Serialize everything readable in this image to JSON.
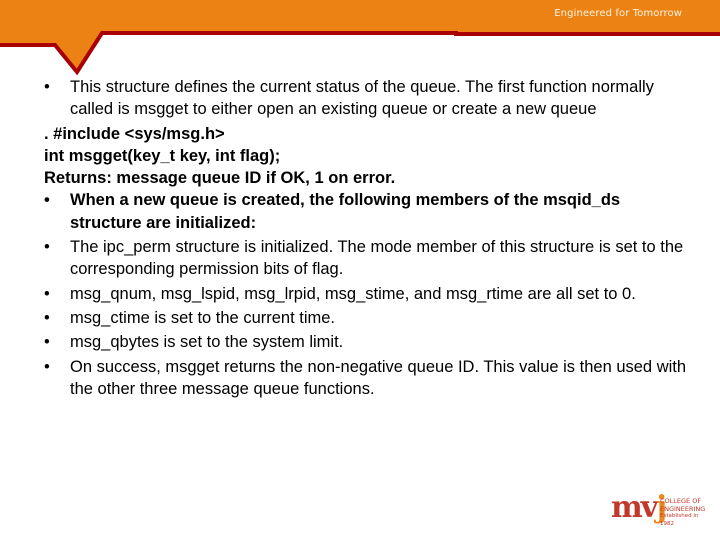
{
  "header": {
    "tagline": "Engineered for Tomorrow",
    "colors": {
      "band": "#ec8213",
      "stroke": "#a80000"
    }
  },
  "content": {
    "items": [
      {
        "type": "bullet",
        "bold": false,
        "text": "This structure defines the current status of the queue. The first function normally called is msgget to either open an existing queue or create a new queue"
      },
      {
        "type": "line",
        "bold": true,
        "text": ". #include <sys/msg.h>"
      },
      {
        "type": "line",
        "bold": true,
        "text": "int msgget(key_t key, int flag);"
      },
      {
        "type": "line",
        "bold": true,
        "text": "Returns: message queue ID if OK, 1 on error."
      },
      {
        "type": "bullet",
        "bold": true,
        "text": "When a new queue is created, the following members of the msqid_ds structure are initialized:"
      },
      {
        "type": "bullet",
        "bold": false,
        "text": "The ipc_perm structure is initialized. The mode member of this structure is set to the corresponding permission bits of flag."
      },
      {
        "type": "bullet",
        "bold": false,
        "text": "msg_qnum, msg_lspid, msg_lrpid, msg_stime, and msg_rtime are all set to 0."
      },
      {
        "type": "bullet",
        "bold": false,
        "text": "msg_ctime is set to the current time."
      },
      {
        "type": "bullet",
        "bold": false,
        "text": "msg_qbytes is set to the system limit."
      },
      {
        "type": "bullet",
        "bold": false,
        "text": "On success, msgget returns the non-negative queue ID. This value is then used with the other three message queue functions."
      }
    ],
    "bullet_glyph": "•"
  },
  "logo": {
    "mark_mv": "mv",
    "mark_j": "j",
    "line1": "COLLEGE OF",
    "line2": "ENGINEERING",
    "line3": "Established in 1982",
    "colors": {
      "primary": "#c0392b",
      "accent": "#e98a1f"
    }
  }
}
